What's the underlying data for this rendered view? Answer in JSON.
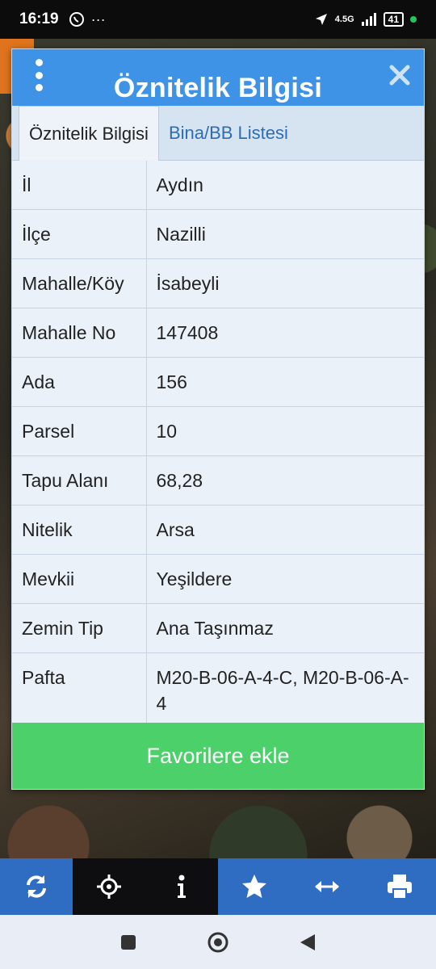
{
  "status": {
    "time": "16:19",
    "network": "4.5G",
    "battery": "41"
  },
  "dialog": {
    "title": "Öznitelik Bilgisi",
    "tabs": [
      {
        "label": "Öznitelik Bilgisi",
        "active": true
      },
      {
        "label": "Bina/BB Listesi",
        "active": false
      }
    ],
    "rows": [
      {
        "key": "İl",
        "value": "Aydın"
      },
      {
        "key": "İlçe",
        "value": "Nazilli"
      },
      {
        "key": "Mahalle/Köy",
        "value": "İsabeyli"
      },
      {
        "key": "Mahalle No",
        "value": "147408"
      },
      {
        "key": "Ada",
        "value": "156"
      },
      {
        "key": "Parsel",
        "value": "10"
      },
      {
        "key": "Tapu Alanı",
        "value": "68,28"
      },
      {
        "key": "Nitelik",
        "value": "Arsa"
      },
      {
        "key": "Mevkii",
        "value": "Yeşildere"
      },
      {
        "key": "Zemin Tip",
        "value": "Ana Taşınmaz"
      },
      {
        "key": "Pafta",
        "value": "M20-B-06-A-4-C,   M20-B-06-A-4"
      }
    ],
    "favorite_button": "Favorilere ekle"
  },
  "toolbar": {
    "items": [
      "refresh-icon",
      "locate-crosshair-icon",
      "info-icon",
      "star-icon",
      "measure-arrows-icon",
      "print-icon"
    ],
    "active": "info-icon"
  },
  "colors": {
    "header_blue": "#3f93e6",
    "toolbar_blue": "#2f6dc2",
    "button_green": "#4cd06a"
  }
}
